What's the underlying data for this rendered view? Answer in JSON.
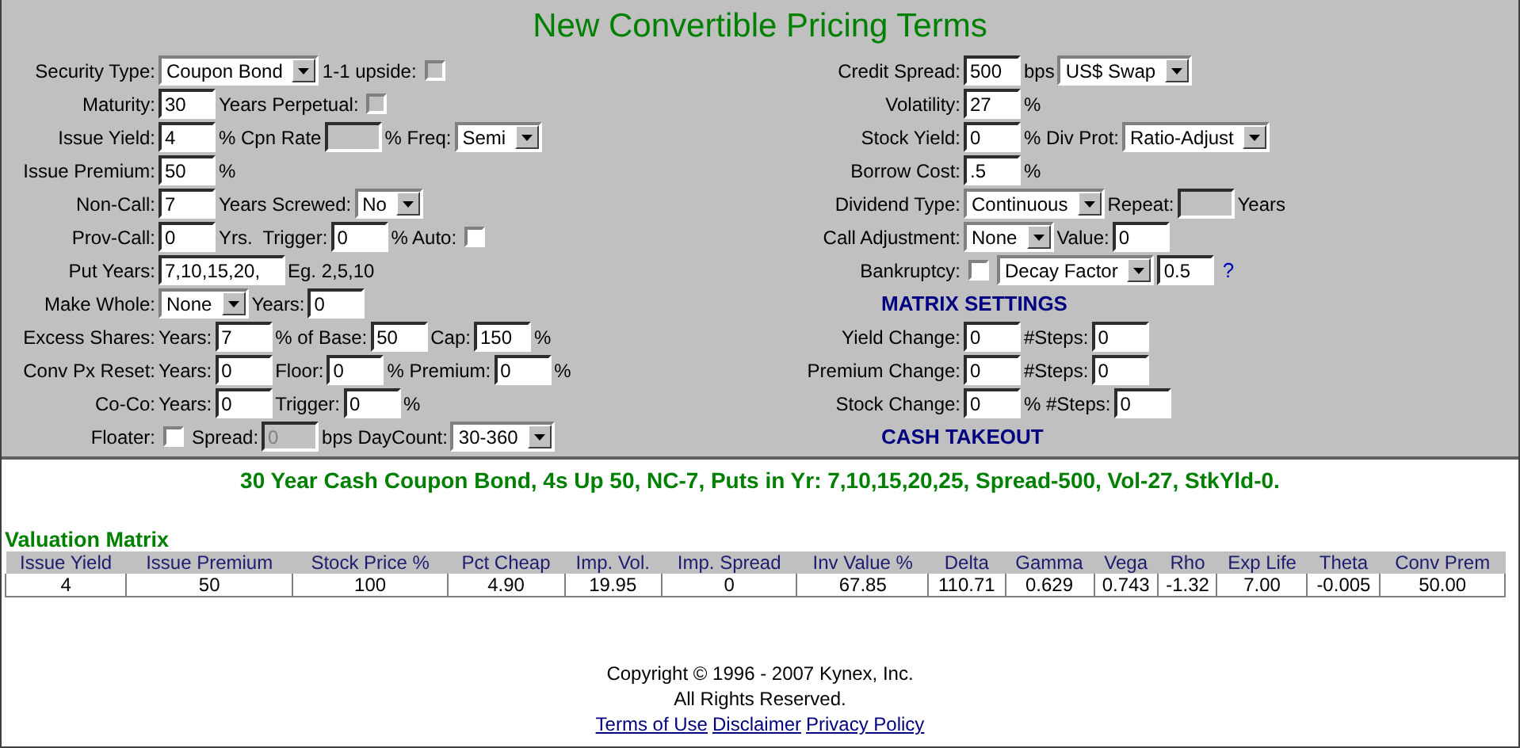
{
  "title": "New Convertible Pricing Terms",
  "left_fields": [
    {
      "label": "Security Type:",
      "controls": [
        {
          "kind": "select",
          "value": "Coupon Bond"
        },
        {
          "kind": "text",
          "text": "1-1 upside:"
        },
        {
          "kind": "checkbox",
          "checked": false,
          "disabled": true
        }
      ]
    },
    {
      "label": "Maturity:",
      "controls": [
        {
          "kind": "input",
          "value": "30"
        },
        {
          "kind": "text",
          "text": "Years Perpetual:"
        },
        {
          "kind": "checkbox",
          "checked": false,
          "disabled": true
        }
      ]
    },
    {
      "label": "Issue Yield:",
      "controls": [
        {
          "kind": "input",
          "value": "4"
        },
        {
          "kind": "text",
          "text": "% Cpn Rate"
        },
        {
          "kind": "input",
          "disabled": true
        },
        {
          "kind": "text",
          "text": "% Freq:"
        },
        {
          "kind": "select",
          "value": "Semi"
        }
      ]
    },
    {
      "label": "Issue Premium:",
      "controls": [
        {
          "kind": "input",
          "value": "50"
        },
        {
          "kind": "text",
          "text": "%"
        }
      ]
    },
    {
      "label": "Non-Call:",
      "controls": [
        {
          "kind": "input",
          "value": "7"
        },
        {
          "kind": "text",
          "text": "Years Screwed:"
        },
        {
          "kind": "select",
          "value": "No"
        }
      ]
    },
    {
      "label": "Prov-Call:",
      "controls": [
        {
          "kind": "input",
          "value": "0"
        },
        {
          "kind": "text",
          "text": "Yrs.  Trigger:"
        },
        {
          "kind": "input",
          "value": "0"
        },
        {
          "kind": "text",
          "text": "% Auto:"
        },
        {
          "kind": "checkbox",
          "checked": false,
          "disabled": false
        }
      ]
    },
    {
      "label": "Put Years:",
      "controls": [
        {
          "kind": "input",
          "value": "7,10,15,20,"
        },
        {
          "kind": "text",
          "text": "Eg. 2,5,10"
        }
      ]
    },
    {
      "label": "Make Whole:",
      "controls": [
        {
          "kind": "select",
          "value": "None"
        },
        {
          "kind": "text",
          "text": "Years:"
        },
        {
          "kind": "input",
          "value": "0"
        }
      ]
    },
    {
      "label": "Excess Shares:",
      "controls": [
        {
          "kind": "text",
          "text": "Years:"
        },
        {
          "kind": "input",
          "value": "7"
        },
        {
          "kind": "text",
          "text": "% of Base:"
        },
        {
          "kind": "input",
          "value": "50"
        },
        {
          "kind": "text",
          "text": "Cap:"
        },
        {
          "kind": "input",
          "value": "150"
        },
        {
          "kind": "text",
          "text": "%"
        }
      ]
    },
    {
      "label": "Conv Px Reset:",
      "controls": [
        {
          "kind": "text",
          "text": "Years:"
        },
        {
          "kind": "input",
          "value": "0"
        },
        {
          "kind": "text",
          "text": "Floor:"
        },
        {
          "kind": "input",
          "value": "0"
        },
        {
          "kind": "text",
          "text": "% Premium:"
        },
        {
          "kind": "input",
          "value": "0"
        },
        {
          "kind": "text",
          "text": "%"
        }
      ]
    },
    {
      "label": "Co-Co:",
      "controls": [
        {
          "kind": "text",
          "text": "Years:"
        },
        {
          "kind": "input",
          "value": "0"
        },
        {
          "kind": "text",
          "text": "Trigger:"
        },
        {
          "kind": "input",
          "value": "0"
        },
        {
          "kind": "text",
          "text": "%"
        }
      ]
    },
    {
      "label": "Floater:",
      "controls": [
        {
          "kind": "checkbox",
          "checked": false,
          "disabled": false
        },
        {
          "kind": "text",
          "text": "Spread:"
        },
        {
          "kind": "input",
          "value": "0",
          "disabled": true
        },
        {
          "kind": "text",
          "text": "bps DayCount:"
        },
        {
          "kind": "select",
          "value": "30-360"
        }
      ]
    }
  ],
  "right_fields": [
    {
      "label": "Credit Spread:",
      "controls": [
        {
          "kind": "input",
          "value": "500"
        },
        {
          "kind": "text",
          "text": "bps"
        },
        {
          "kind": "select",
          "value": "US$ Swap"
        }
      ]
    },
    {
      "label": "Volatility:",
      "controls": [
        {
          "kind": "input",
          "value": "27"
        },
        {
          "kind": "text",
          "text": "%"
        }
      ]
    },
    {
      "label": "Stock Yield:",
      "controls": [
        {
          "kind": "input",
          "value": "0"
        },
        {
          "kind": "text",
          "text": "% Div Prot:"
        },
        {
          "kind": "select",
          "value": "Ratio-Adjust"
        }
      ]
    },
    {
      "label": "Borrow Cost:",
      "controls": [
        {
          "kind": "input",
          "value": ".5"
        },
        {
          "kind": "text",
          "text": "%"
        }
      ]
    },
    {
      "label": "Dividend Type:",
      "controls": [
        {
          "kind": "select",
          "value": "Continuous"
        },
        {
          "kind": "text",
          "text": "Repeat:"
        },
        {
          "kind": "input",
          "disabled": true
        },
        {
          "kind": "text",
          "text": "Years"
        }
      ]
    },
    {
      "label": "Call Adjustment:",
      "controls": [
        {
          "kind": "select",
          "value": "None"
        },
        {
          "kind": "text",
          "text": "Value:"
        },
        {
          "kind": "input",
          "value": "0"
        }
      ]
    },
    {
      "label": "Bankruptcy:",
      "controls": [
        {
          "kind": "checkbox",
          "checked": false,
          "disabled": false
        },
        {
          "kind": "select",
          "value": "Decay Factor"
        },
        {
          "kind": "input",
          "value": "0.5"
        },
        {
          "kind": "link",
          "text": "?"
        }
      ]
    },
    {
      "kind": "heading",
      "label": "MATRIX SETTINGS"
    },
    {
      "label": "Yield Change:",
      "controls": [
        {
          "kind": "input",
          "value": "0"
        },
        {
          "kind": "text",
          "text": "#Steps:"
        },
        {
          "kind": "input",
          "value": "0"
        }
      ]
    },
    {
      "label": "Premium Change:",
      "controls": [
        {
          "kind": "input",
          "value": "0"
        },
        {
          "kind": "text",
          "text": "#Steps:"
        },
        {
          "kind": "input",
          "value": "0"
        }
      ]
    },
    {
      "label": "Stock Change:",
      "controls": [
        {
          "kind": "input",
          "value": "0"
        },
        {
          "kind": "text",
          "text": "% #Steps:"
        },
        {
          "kind": "input",
          "value": "0"
        }
      ]
    },
    {
      "kind": "heading",
      "label": "CASH TAKEOUT"
    }
  ],
  "summary": "30 Year Cash Coupon Bond, 4s Up 50, NC-7, Puts in Yr: 7,10,15,20,25, Spread-500, Vol-27, StkYld-0.",
  "matrix": {
    "title": "Valuation Matrix",
    "columns": [
      "Issue Yield",
      "Issue Premium",
      "Stock Price %",
      "Pct Cheap",
      "Imp. Vol.",
      "Imp. Spread",
      "Inv Value %",
      "Delta",
      "Gamma",
      "Vega",
      "Rho",
      "Exp Life",
      "Theta",
      "Conv Prem"
    ],
    "rows": [
      [
        "4",
        "50",
        "100",
        "4.90",
        "19.95",
        "0",
        "67.85",
        "110.71",
        "0.629",
        "0.743",
        "-1.32",
        "7.00",
        "-0.005",
        "50.00"
      ]
    ]
  },
  "footer": {
    "copyright": "Copyright © 1996 - 2007 Kynex, Inc.",
    "rights": "All Rights Reserved.",
    "links": [
      "Terms of Use",
      "Disclaimer",
      "Privacy Policy"
    ]
  }
}
